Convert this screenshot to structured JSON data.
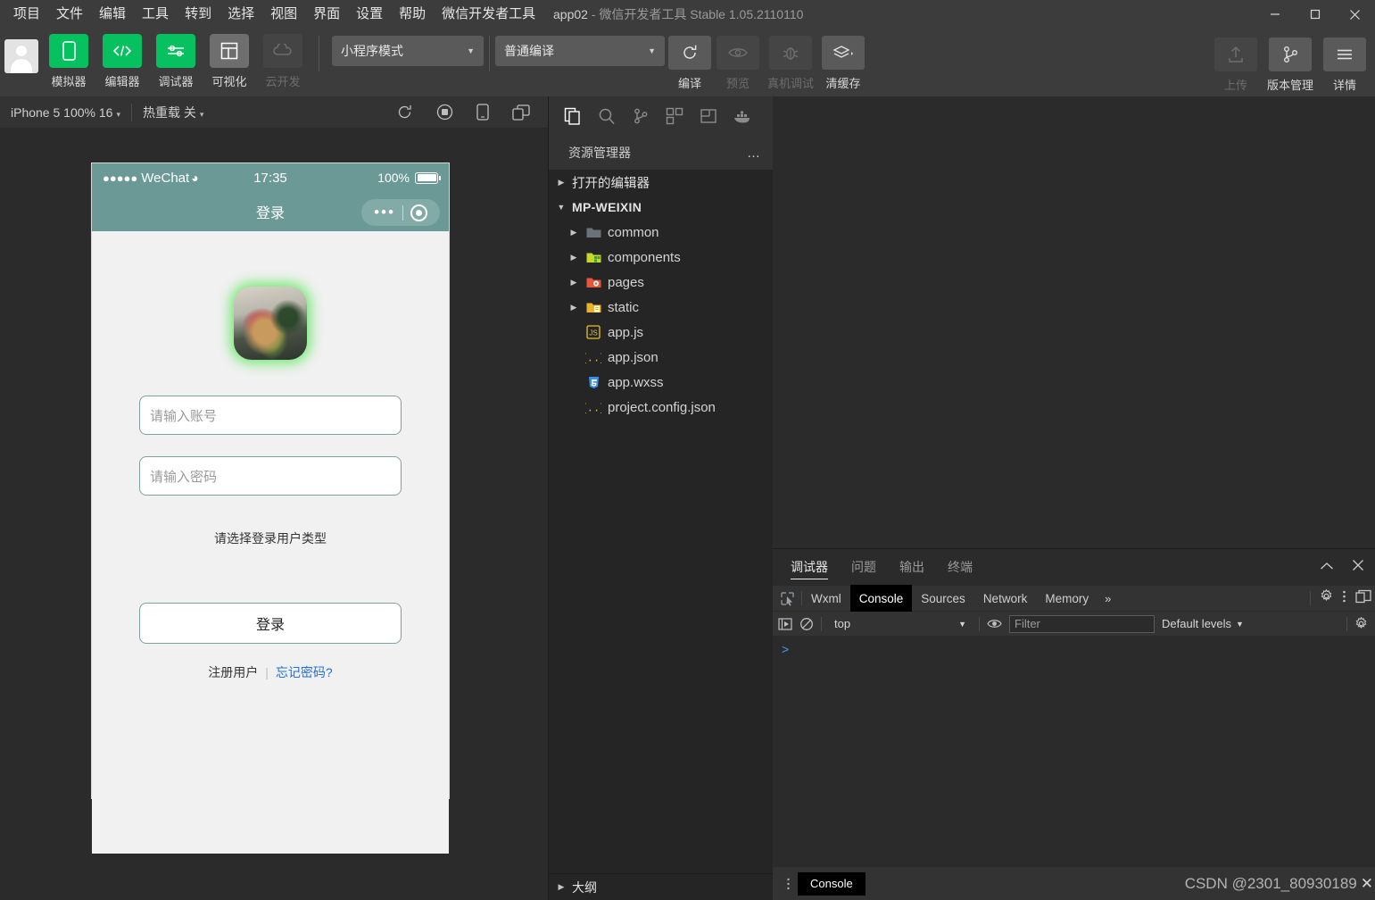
{
  "titlebar": {
    "menus": [
      "项目",
      "文件",
      "编辑",
      "工具",
      "转到",
      "选择",
      "视图",
      "界面",
      "设置",
      "帮助",
      "微信开发者工具"
    ],
    "project_name": "app02",
    "title_suffix": " -  微信开发者工具 Stable 1.05.2110110",
    "window_controls": {
      "minimize": "minimize-icon",
      "maximize": "maximize-icon",
      "close": "close-icon"
    }
  },
  "toolbar": {
    "avatar": "user-avatar",
    "buttons": [
      {
        "label": "模拟器",
        "icon": "phone-icon",
        "style": "green",
        "enabled": true
      },
      {
        "label": "编辑器",
        "icon": "code-icon",
        "style": "green",
        "enabled": true
      },
      {
        "label": "调试器",
        "icon": "sliders-icon",
        "style": "green",
        "enabled": true
      },
      {
        "label": "可视化",
        "icon": "layout-icon",
        "style": "gray",
        "enabled": true
      },
      {
        "label": "云开发",
        "icon": "cloud-icon",
        "style": "dim",
        "enabled": false
      }
    ],
    "mode_select": "小程序模式",
    "compile_select": "普通编译",
    "actions": [
      {
        "label": "编译",
        "icon": "refresh-icon",
        "enabled": true
      },
      {
        "label": "预览",
        "icon": "eye-icon",
        "enabled": false
      },
      {
        "label": "真机调试",
        "icon": "bug-icon",
        "enabled": false
      },
      {
        "label": "清缓存",
        "icon": "layers-icon",
        "enabled": true
      }
    ],
    "right_actions": [
      {
        "label": "上传",
        "icon": "upload-icon",
        "enabled": false
      },
      {
        "label": "版本管理",
        "icon": "git-branch-icon",
        "enabled": true
      },
      {
        "label": "详情",
        "icon": "hamburger-icon",
        "enabled": true
      }
    ]
  },
  "simulator": {
    "device_select": "iPhone 5 100% 16",
    "hot_reload": "热重载 关",
    "icons": [
      "refresh-icon",
      "record-icon",
      "device-icon",
      "multi-window-icon"
    ],
    "phone": {
      "status_bar": {
        "dots": "●●●●●",
        "carrier": "WeChat",
        "wifi": "wifi-icon",
        "time": "17:35",
        "battery_percent": "100%"
      },
      "nav_title": "登录",
      "capsule": {
        "menu": "more-dots-icon",
        "target": "target-icon"
      },
      "logo": "app-logo-image",
      "account_placeholder": "请输入账号",
      "password_placeholder": "请输入密码",
      "user_type_label": "请选择登录用户类型",
      "login_button": "登录",
      "register_link": "注册用户",
      "link_separator": "|",
      "forgot_link": "忘记密码?"
    }
  },
  "explorer": {
    "activity_icons": [
      "files-icon",
      "search-icon",
      "source-control-icon",
      "extensions-icon",
      "custom-panel-icon",
      "docker-icon"
    ],
    "title": "资源管理器",
    "more": "…",
    "sections": [
      {
        "label": "打开的编辑器",
        "expanded": false
      },
      {
        "label": "MP-WEIXIN",
        "expanded": true
      }
    ],
    "tree": [
      {
        "label": "common",
        "type": "folder",
        "color": "#6a737d",
        "expandable": true
      },
      {
        "label": "components",
        "type": "folder",
        "color": "#c5d92b",
        "expandable": true
      },
      {
        "label": "pages",
        "type": "folder",
        "color": "#e8553b",
        "expandable": true
      },
      {
        "label": "static",
        "type": "folder",
        "color": "#e8b32b",
        "expandable": true
      },
      {
        "label": "app.js",
        "type": "js",
        "color": "#e8c02b",
        "expandable": false
      },
      {
        "label": "app.json",
        "type": "json",
        "color": "#e8c02b",
        "expandable": false
      },
      {
        "label": "app.wxss",
        "type": "css",
        "color": "#3b8ee8",
        "expandable": false
      },
      {
        "label": "project.config.json",
        "type": "json",
        "color": "#e8c02b",
        "expandable": false
      }
    ],
    "outline": "大纲"
  },
  "debugger": {
    "panel_tabs": [
      {
        "label": "调试器",
        "active": true
      },
      {
        "label": "问题",
        "active": false
      },
      {
        "label": "输出",
        "active": false
      },
      {
        "label": "终端",
        "active": false
      }
    ],
    "panel_controls": {
      "collapse": "chevron-up-icon",
      "close": "close-icon"
    },
    "devtools_tabs": [
      {
        "label": "Wxml",
        "active": false
      },
      {
        "label": "Console",
        "active": true
      },
      {
        "label": "Sources",
        "active": false
      },
      {
        "label": "Network",
        "active": false
      },
      {
        "label": "Memory",
        "active": false
      }
    ],
    "more_tabs": "»",
    "devtools_right_icons": [
      "settings-gear-icon",
      "kebab-menu-icon",
      "dock-side-icon"
    ],
    "console_toolbar": {
      "execute_icon": "execute-icon",
      "clear_icon": "clear-console-icon",
      "context": "top",
      "eye_icon": "live-expression-icon",
      "filter_placeholder": "Filter",
      "levels": "Default levels",
      "settings_icon": "settings-gear-icon"
    },
    "prompt": ">",
    "drawer": {
      "kebab": "kebab-menu-icon",
      "tab": "Console"
    },
    "watermark": "CSDN @2301_80930189",
    "watermark_close": "✕"
  },
  "colors": {
    "accent_green": "#07c160",
    "panel_bg": "#2b2b2b",
    "titlebar_bg": "#3c3c3c",
    "explorer_bg": "#252526",
    "phone_header": "#6b9a96",
    "link_blue": "#1f6fe0"
  }
}
